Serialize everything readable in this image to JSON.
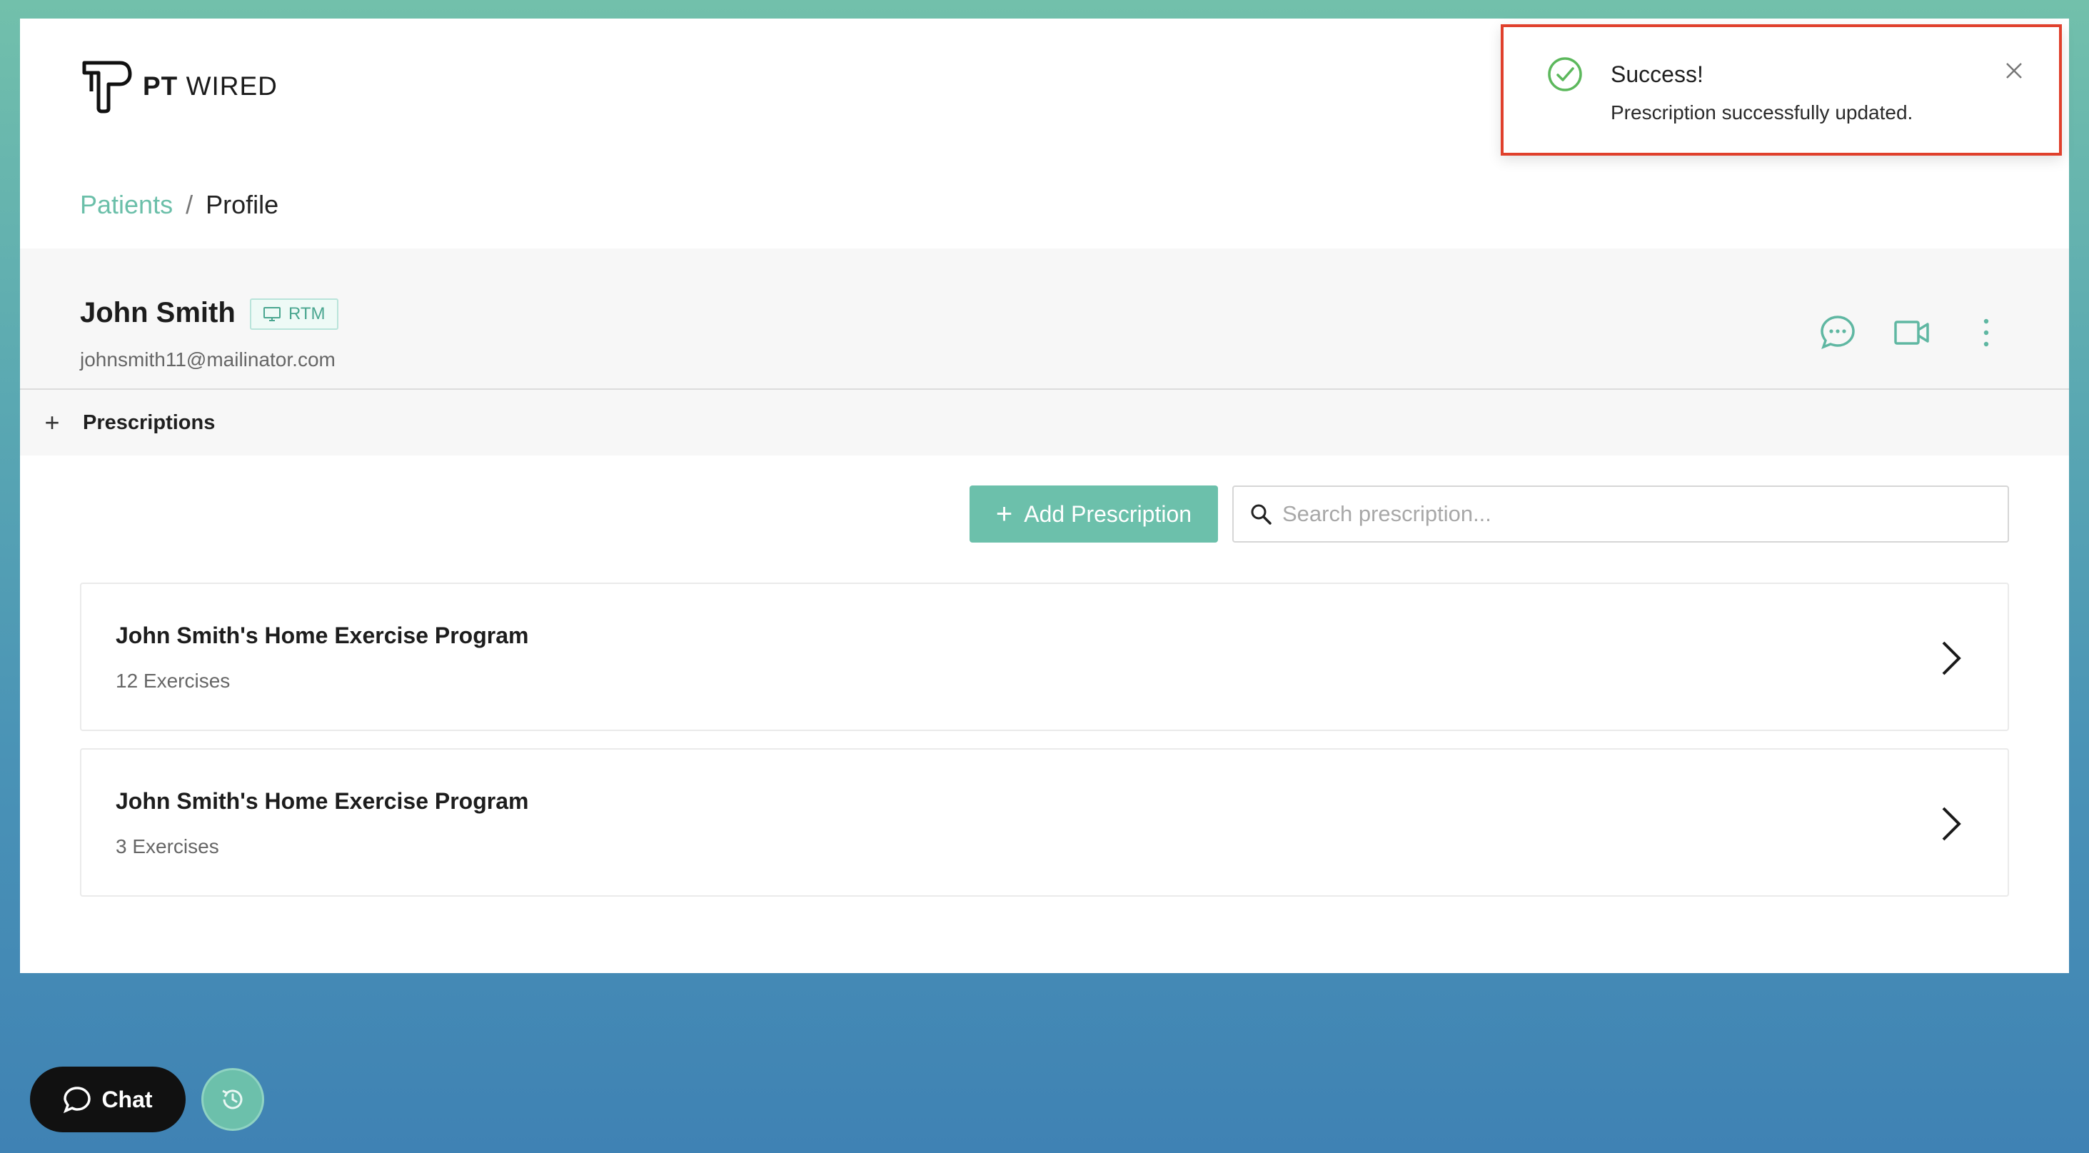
{
  "brand": {
    "logo_bold": "PT",
    "logo_light": "WIRED"
  },
  "breadcrumb": {
    "parent": "Patients",
    "separator": "/",
    "current": "Profile"
  },
  "patient": {
    "name": "John Smith",
    "badge": "RTM",
    "email": "johnsmith11@mailinator.com"
  },
  "section": {
    "title": "Prescriptions",
    "toggle": "+"
  },
  "toolbar": {
    "add_label": "Add Prescription",
    "search_placeholder": "Search prescription..."
  },
  "prescriptions": [
    {
      "title": "John Smith's Home Exercise Program",
      "count": "12 Exercises"
    },
    {
      "title": "John Smith's Home Exercise Program",
      "count": "3 Exercises"
    }
  ],
  "toast": {
    "title": "Success!",
    "message": "Prescription successfully updated."
  },
  "chat": {
    "label": "Chat"
  },
  "colors": {
    "accent": "#6cc0ab",
    "toast_border": "#e0402c",
    "success": "#5cb85c"
  }
}
